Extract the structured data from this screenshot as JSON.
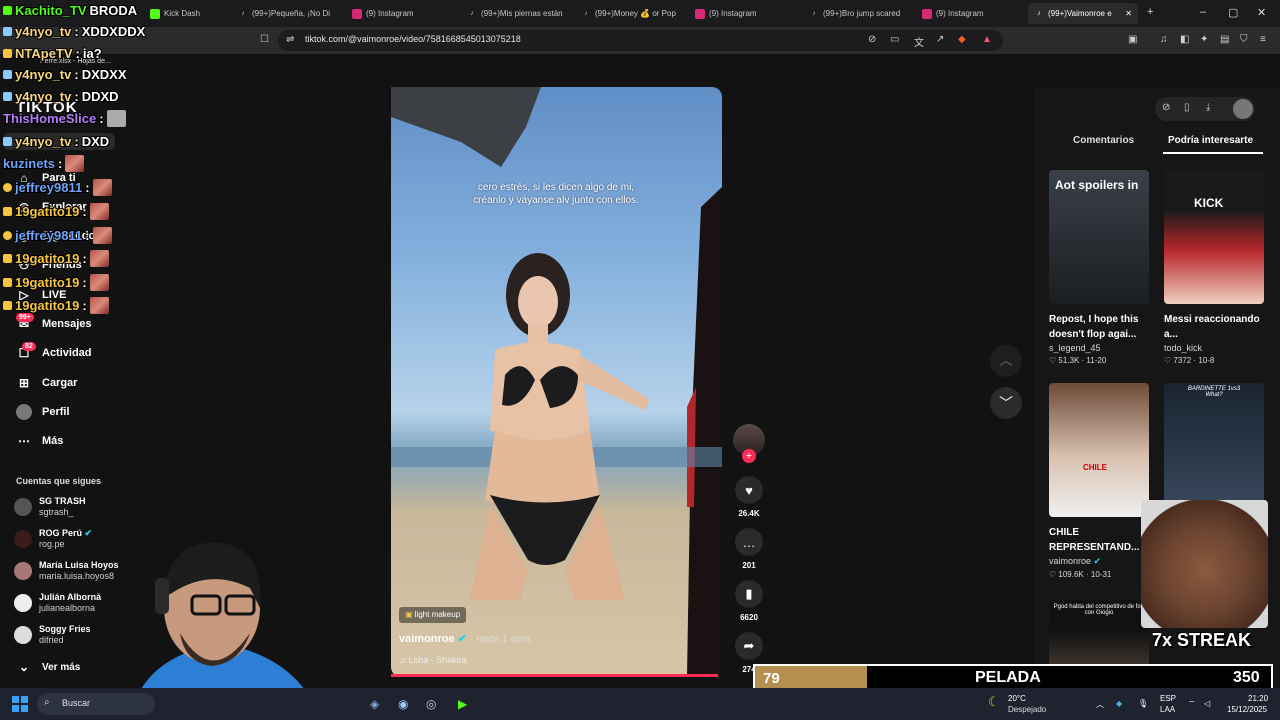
{
  "browser": {
    "tabs": [
      {
        "label": "Kachito_TV",
        "icon": "kick-icon",
        "color": "#53fc18"
      },
      {
        "label": "Kick Dash",
        "icon": "kick-icon",
        "color": "#53fc18"
      },
      {
        "label": "(99+)Pequeña, ¡No Di",
        "icon": "tiktok-icon",
        "color": "#000000"
      },
      {
        "label": "(9) Instagram",
        "icon": "instagram-icon",
        "color": "#d62976"
      },
      {
        "label": "(99+)Mis piernas están",
        "icon": "tiktok-icon",
        "color": "#000000"
      },
      {
        "label": "(99+)Money 💰 or Pop",
        "icon": "tiktok-icon",
        "color": "#000000"
      },
      {
        "label": "(9) Instagram",
        "icon": "instagram-icon",
        "color": "#d62976"
      },
      {
        "label": "(99+)Bro jump scared",
        "icon": "tiktok-icon",
        "color": "#000000"
      },
      {
        "label": "(9) Instagram",
        "icon": "instagram-icon",
        "color": "#d62976"
      },
      {
        "label": "(99+)Vaimonroe e",
        "icon": "tiktok-icon",
        "color": "#000000",
        "active": true
      }
    ],
    "url": "tiktok.com/@vaimonroe/video/7581668545013075218",
    "bookmark": "Perre.xlsx - Hojas de..."
  },
  "chat": [
    {
      "user": "Kachito_TV",
      "message": "BRODA",
      "color": "#53fc18"
    },
    {
      "user": "y4nyo_tv",
      "message": "XDDXDDX",
      "color": "#f5d67c"
    },
    {
      "user": "NTApeTV",
      "message": "ia?",
      "color": "#f5d67c"
    },
    {
      "user": "y4nyo_tv",
      "message": "DXDXX",
      "color": "#f5d67c"
    },
    {
      "user": "y4nyo_tv",
      "message": "DDXD",
      "color": "#f5d67c"
    },
    {
      "user": "ThisHomeSlice",
      "message": "",
      "color": "#b67ef5"
    },
    {
      "user": "y4nyo_tv",
      "message": "DXD",
      "color": "#f5d67c"
    },
    {
      "user": "kuzinets",
      "message": "",
      "color": "#6ea3f5"
    },
    {
      "user": "jeffrey9811",
      "message": "",
      "color": "#6ea3f5"
    },
    {
      "user": "19gatito19",
      "message": "",
      "color": "#f5c542"
    },
    {
      "user": "jeffrey9811",
      "message": "",
      "color": "#6ea3f5"
    },
    {
      "user": "19gatito19",
      "message": "",
      "color": "#f5c542"
    },
    {
      "user": "19gatito19",
      "message": "",
      "color": "#f5c542"
    },
    {
      "user": "19gatito19",
      "message": "",
      "color": "#f5c542"
    }
  ],
  "tiktok": {
    "logo": "TIKTOK",
    "nav": [
      {
        "label": "Para ti",
        "icon": "home-icon"
      },
      {
        "label": "Explorar",
        "icon": "compass-icon"
      },
      {
        "label": "Siguiendo",
        "icon": "following-icon"
      },
      {
        "label": "Friends",
        "icon": "friends-icon"
      },
      {
        "label": "LIVE",
        "icon": "live-icon"
      },
      {
        "label": "Mensajes",
        "icon": "message-icon",
        "badge": "99+"
      },
      {
        "label": "Actividad",
        "icon": "activity-icon",
        "badge": "82"
      },
      {
        "label": "Cargar",
        "icon": "upload-icon"
      },
      {
        "label": "Perfil",
        "icon": "profile-icon"
      },
      {
        "label": "Más",
        "icon": "more-icon"
      }
    ],
    "following_title": "Cuentas que sigues",
    "following": [
      {
        "name": "SG TRASH",
        "handle": "sgtrash_"
      },
      {
        "name": "ROG Perú",
        "handle": "rog.pe",
        "verified": true
      },
      {
        "name": "María Luisa Hoyos",
        "handle": "maria.luisa.hoyos8"
      },
      {
        "name": "Julián Albornà",
        "handle": "julianealborna"
      },
      {
        "name": "Soggy Fries",
        "handle": "difried"
      }
    ],
    "see_more": "Ver más",
    "video": {
      "caption": "cero estrés, si les dicen algo de mi, créanlo y váyanse alv junto con ellos.",
      "effect_label": "light makeup",
      "author": "vaimonroe",
      "time": "· Hace 1 sem.",
      "song": "Loba - Shakira"
    },
    "actions": [
      {
        "icon": "heart-icon",
        "count": "26.4K"
      },
      {
        "icon": "comment-icon",
        "count": "201"
      },
      {
        "icon": "bookmark-icon",
        "count": "6620"
      },
      {
        "icon": "share-icon",
        "count": "274"
      }
    ],
    "right_tabs": [
      "Comentarios",
      "Podría interesarte"
    ],
    "cards": [
      {
        "title": "Repost, I hope this doesn't flop agai...",
        "user": "s_legend_45",
        "likes": "51.3K",
        "date": "11-20",
        "thumb_text": "Aot spoilers in"
      },
      {
        "title": "Messi reaccionando a...",
        "user": "todo_kick",
        "likes": "7372",
        "date": "10-8",
        "thumb_text": "KICK"
      },
      {
        "title": "CHILE REPRESENTAND...",
        "user": "vaimonroe",
        "likes": "109.6K",
        "date": "10-31",
        "thumb_text": "CHILE"
      },
      {
        "title": "",
        "user": "",
        "likes": "",
        "date": "",
        "thumb_text": "BARDINETTE 1vs3 What?"
      }
    ],
    "bottom_thumb_text": "Pgod habla del competitivo de fort con Giogio"
  },
  "overlays": {
    "streak": "7x STREAK",
    "score_left": "79",
    "score_label": "PELADA",
    "score_right": "350"
  },
  "taskbar": {
    "search": "Buscar",
    "weather_temp": "20°C",
    "weather_desc": "Despejado",
    "lang": "ESP",
    "lang2": "LAA",
    "time": "21:20",
    "date": "15/12/2025"
  }
}
